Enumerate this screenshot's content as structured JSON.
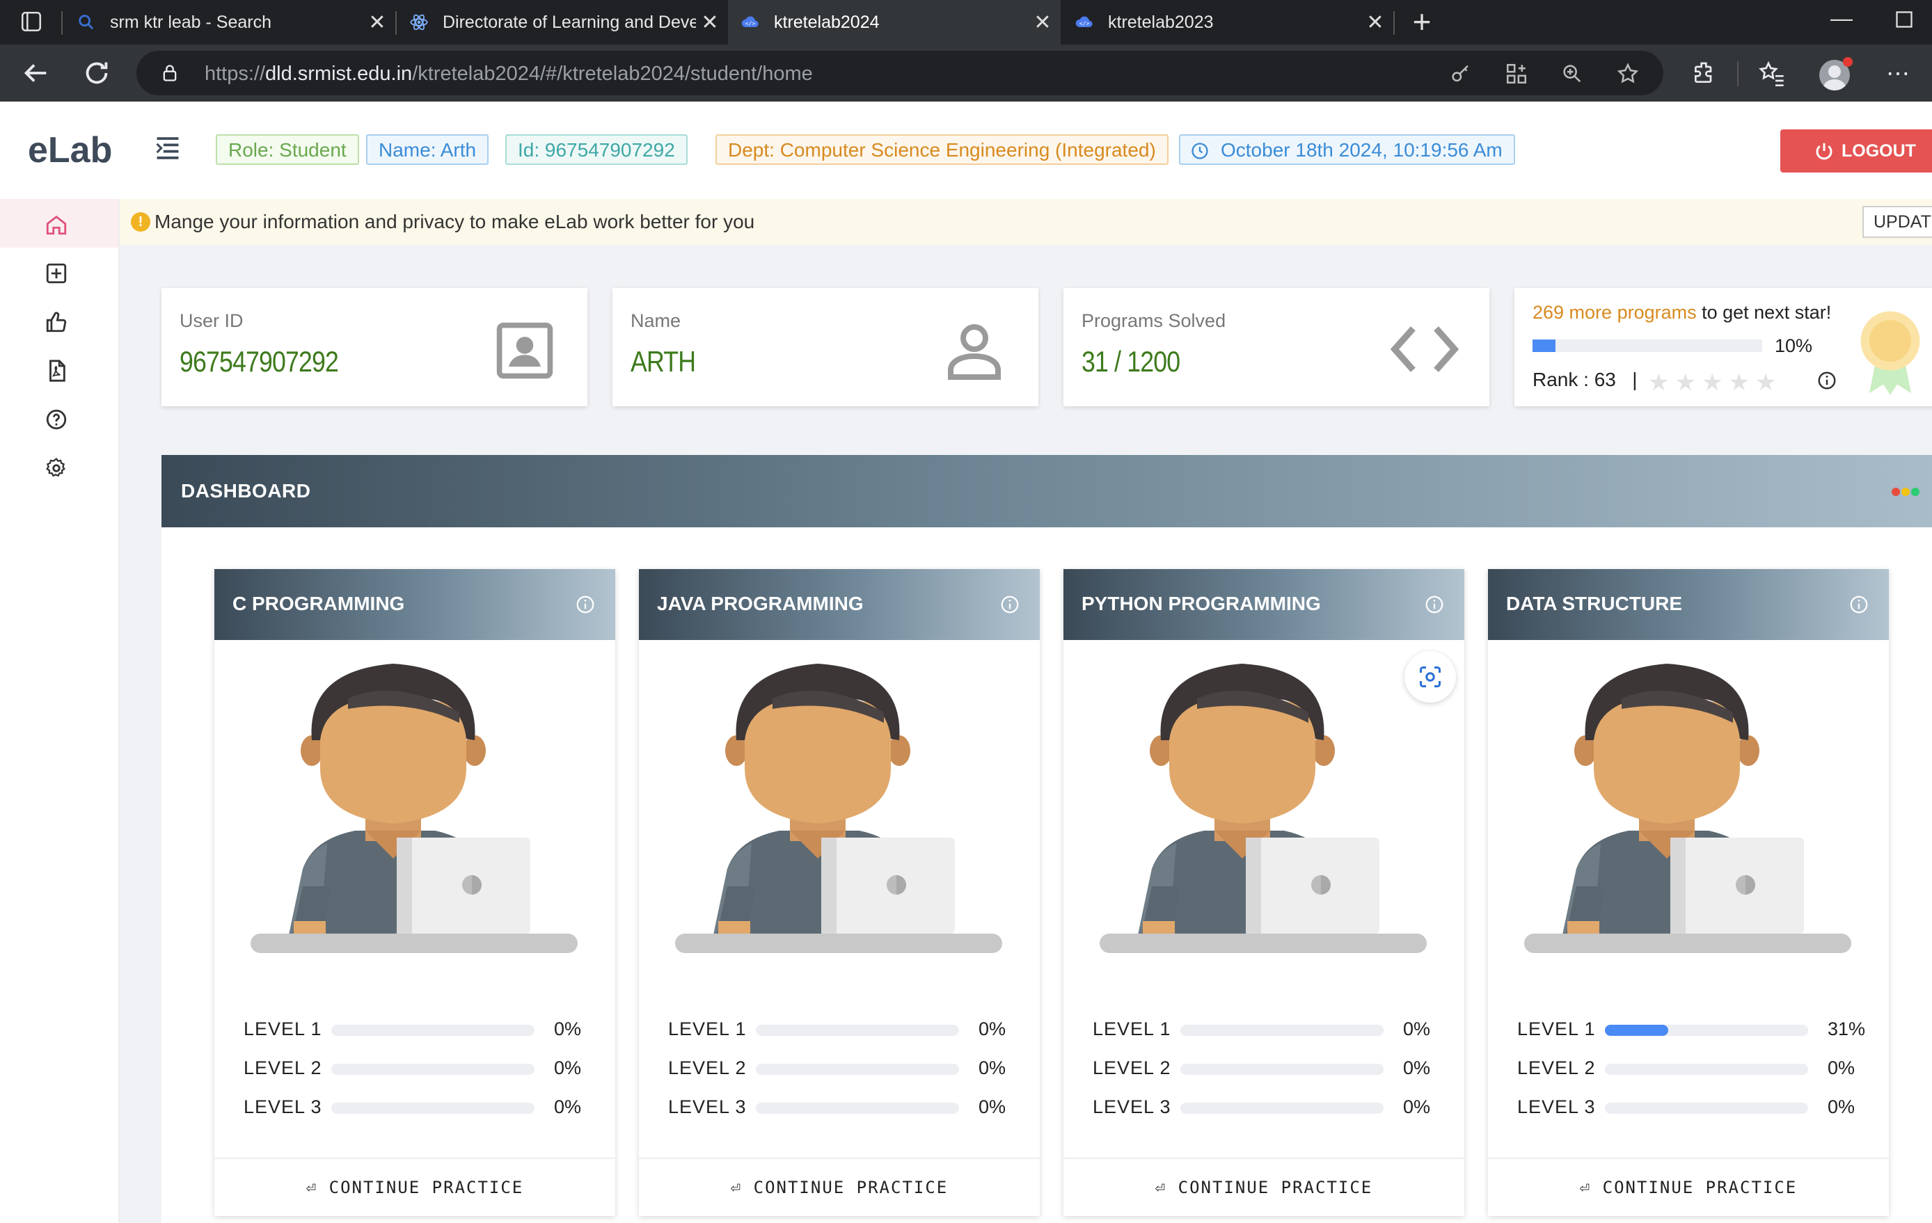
{
  "browser": {
    "tabs": [
      {
        "label": "srm ktr leab - Search",
        "icon": "search-icon",
        "active": false
      },
      {
        "label": "Directorate of Learning and Devel",
        "icon": "react-icon",
        "active": false
      },
      {
        "label": "ktretelab2024",
        "icon": "cloud-code-icon",
        "active": true
      },
      {
        "label": "ktretelab2023",
        "icon": "cloud-code-icon",
        "active": false
      }
    ],
    "url_scheme": "https://",
    "url_host": "dld.srmist.edu.in",
    "url_path": "/ktretelab2024/#/ktretelab2024/student/home",
    "close_glyph": "✕",
    "new_tab_glyph": "+"
  },
  "header": {
    "logo": "eLab",
    "role": "Role: Student",
    "name": "Name: Arth",
    "id": "Id: 967547907292",
    "dept": "Dept: Computer Science Engineering (Integrated)",
    "datetime": "October 18th 2024, 10:19:56 Am",
    "logout_label": "LOGOUT"
  },
  "sidebar": {
    "items": [
      {
        "icon": "home-icon",
        "active": true
      },
      {
        "icon": "add-square-icon",
        "active": false
      },
      {
        "icon": "thumbs-up-icon",
        "active": false
      },
      {
        "icon": "pdf-file-icon",
        "active": false
      },
      {
        "icon": "help-circle-icon",
        "active": false
      },
      {
        "icon": "settings-gear-icon",
        "active": false
      }
    ]
  },
  "notice": {
    "text": "Mange your information and privacy to make eLab work better for you",
    "button": "UPDATE"
  },
  "stats": {
    "user_id_label": "User ID",
    "user_id_value": "967547907292",
    "name_label": "Name",
    "name_value": "ARTH",
    "programs_label": "Programs Solved",
    "programs_value": "31 / 1200"
  },
  "rank": {
    "next_count": "269 more programs",
    "next_suffix": " to get next star!",
    "progress_percent": 10,
    "progress_label": "10%",
    "rank_label": "Rank : 63",
    "rank_sep": "|",
    "stars_filled": 0,
    "stars_total": 5,
    "stars_glyphs": "★★★★★"
  },
  "dashboard": {
    "title": "DASHBOARD",
    "dot_colors": [
      "#e74c3c",
      "#f1c40f",
      "#2ecc71"
    ]
  },
  "courses": [
    {
      "title": "C PROGRAMMING",
      "levels": [
        {
          "name": "LEVEL 1",
          "percent": 0,
          "label": "0%"
        },
        {
          "name": "LEVEL 2",
          "percent": 0,
          "label": "0%"
        },
        {
          "name": "LEVEL 3",
          "percent": 0,
          "label": "0%"
        }
      ],
      "button": "⏎ CONTINUE PRACTICE"
    },
    {
      "title": "JAVA PROGRAMMING",
      "levels": [
        {
          "name": "LEVEL 1",
          "percent": 0,
          "label": "0%"
        },
        {
          "name": "LEVEL 2",
          "percent": 0,
          "label": "0%"
        },
        {
          "name": "LEVEL 3",
          "percent": 0,
          "label": "0%"
        }
      ],
      "button": "⏎ CONTINUE PRACTICE"
    },
    {
      "title": "PYTHON PROGRAMMING",
      "levels": [
        {
          "name": "LEVEL 1",
          "percent": 0,
          "label": "0%"
        },
        {
          "name": "LEVEL 2",
          "percent": 0,
          "label": "0%"
        },
        {
          "name": "LEVEL 3",
          "percent": 0,
          "label": "0%"
        }
      ],
      "button": "⏎ CONTINUE PRACTICE"
    },
    {
      "title": "DATA STRUCTURE",
      "levels": [
        {
          "name": "LEVEL 1",
          "percent": 31,
          "label": "31%"
        },
        {
          "name": "LEVEL 2",
          "percent": 0,
          "label": "0%"
        },
        {
          "name": "LEVEL 3",
          "percent": 0,
          "label": "0%"
        }
      ],
      "button": "⏎ CONTINUE PRACTICE"
    }
  ],
  "colors": {
    "logout": "#e55353",
    "accent_green": "#3d7a1c",
    "progress_blue": "#4a8af4",
    "rank_orange": "#d88a1f"
  }
}
